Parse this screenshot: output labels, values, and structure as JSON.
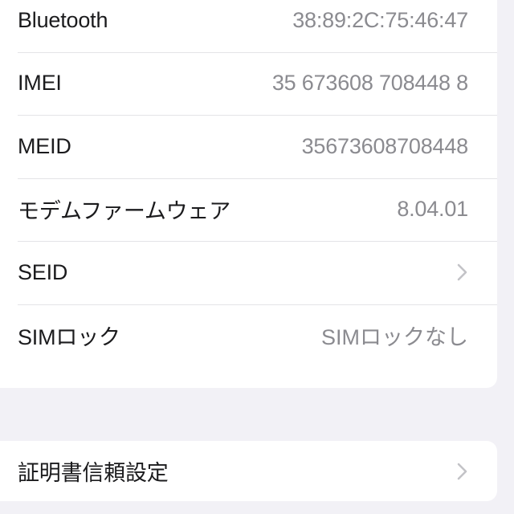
{
  "theme": {
    "background": "#f2f1f6",
    "card_background": "#ffffff",
    "label_color": "#1b1b1d",
    "value_color": "#8b8b90",
    "separator_color": "#e4e4e7",
    "chevron_color": "#c3c3c7"
  },
  "sections": [
    {
      "id": "device-info",
      "rows": [
        {
          "label": "Bluetooth",
          "value": "38:89:2C:75:46:47",
          "accessory": "none"
        },
        {
          "label": "IMEI",
          "value": "35 673608 708448 8",
          "accessory": "none"
        },
        {
          "label": "MEID",
          "value": "35673608708448",
          "accessory": "none"
        },
        {
          "label": "モデムファームウェア",
          "value": "8.04.01",
          "accessory": "none"
        },
        {
          "label": "SEID",
          "value": "",
          "accessory": "chevron"
        },
        {
          "label": "SIMロック",
          "value": "SIMロックなし",
          "accessory": "none"
        }
      ]
    },
    {
      "id": "certificate",
      "rows": [
        {
          "label": "証明書信頼設定",
          "value": "",
          "accessory": "chevron"
        }
      ]
    }
  ],
  "icons": {
    "chevron_right": "chevron-right-icon"
  }
}
